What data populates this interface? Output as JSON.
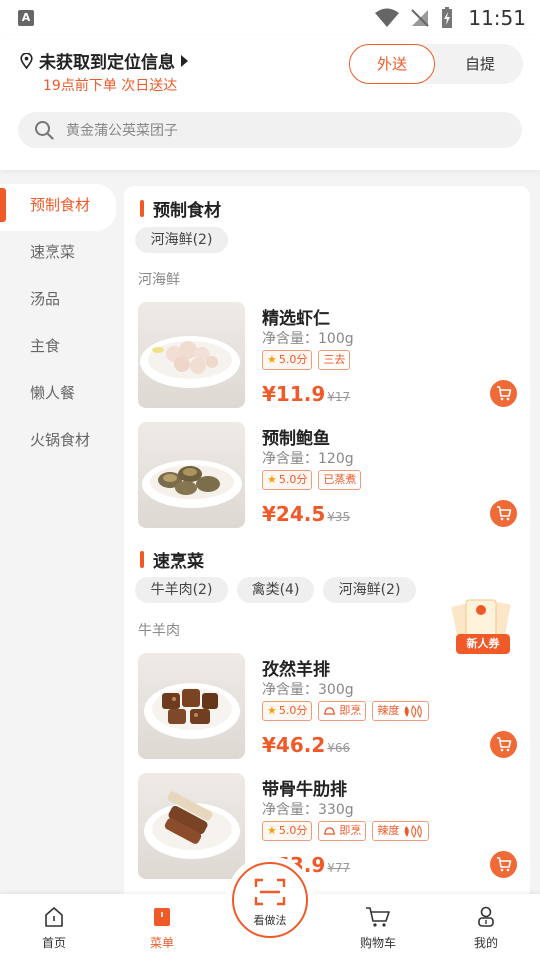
{
  "status_bar": {
    "time": "11:51",
    "app_icon_letter": "A"
  },
  "header": {
    "location_text": "未获取到定位信息",
    "delivery_note": "19点前下单 次日送达",
    "modes": [
      "外送",
      "自提"
    ],
    "active_mode": "外送"
  },
  "search": {
    "placeholder": "黄金蒲公英菜团子"
  },
  "sidebar": {
    "items": [
      {
        "label": "预制食材",
        "active": true
      },
      {
        "label": "速烹菜",
        "active": false
      },
      {
        "label": "汤品",
        "active": false
      },
      {
        "label": "主食",
        "active": false
      },
      {
        "label": "懒人餐",
        "active": false
      },
      {
        "label": "火锅食材",
        "active": false
      }
    ]
  },
  "sections": [
    {
      "title": "预制食材",
      "chips": [
        "河海鲜(2)"
      ],
      "subhead": "河海鲜",
      "products": [
        {
          "name": "精选虾仁",
          "spec": "净含量：100g",
          "rating": "5.0分",
          "tags": [
            "三去"
          ],
          "price": "¥11.9",
          "old_price": "¥17"
        },
        {
          "name": "预制鲍鱼",
          "spec": "净含量：120g",
          "rating": "5.0分",
          "tags": [
            "已蒸煮"
          ],
          "price": "¥24.5",
          "old_price": "¥35"
        }
      ]
    },
    {
      "title": "速烹菜",
      "chips": [
        "牛羊肉(2)",
        "禽类(4)",
        "河海鲜(2)"
      ],
      "subhead": "牛羊肉",
      "products": [
        {
          "name": "孜然羊排",
          "spec": "净含量：300g",
          "rating": "5.0分",
          "tags": [
            "即烹",
            "辣度"
          ],
          "price": "¥46.2",
          "old_price": "¥66"
        },
        {
          "name": "带骨牛肋排",
          "spec": "净含量：330g",
          "rating": "5.0分",
          "tags": [
            "即烹",
            "辣度"
          ],
          "price": "¥53.9",
          "old_price": "¥77"
        }
      ]
    }
  ],
  "coupon": {
    "label": "新人券"
  },
  "bottom_nav": {
    "tabs": [
      {
        "label": "首页",
        "icon": "home-icon"
      },
      {
        "label": "菜单",
        "icon": "menu-icon",
        "active": true
      },
      {
        "label": "看做法",
        "icon": "scan-icon"
      },
      {
        "label": "购物车",
        "icon": "cart-icon"
      },
      {
        "label": "我的",
        "icon": "user-icon"
      }
    ]
  },
  "colors": {
    "accent": "#f05a28",
    "background": "#f4f4f4"
  }
}
